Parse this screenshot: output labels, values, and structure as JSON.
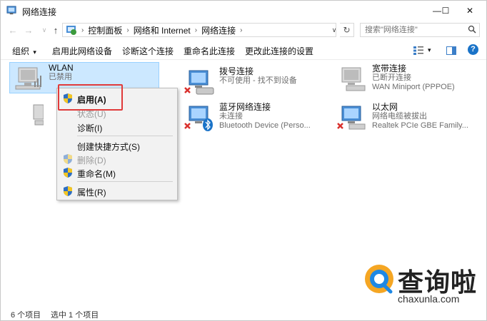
{
  "window": {
    "title": "网络连接",
    "minimize_glyph": "—",
    "maximize_glyph": "☐",
    "close_glyph": "✕"
  },
  "address": {
    "back_glyph": "←",
    "forward_glyph": "→",
    "up_glyph": "↑",
    "breadcrumb": [
      "控制面板",
      "网络和 Internet",
      "网络连接"
    ],
    "separator": "›",
    "dropdown_glyph": "∨",
    "refresh_glyph": "↻",
    "search_placeholder": "搜索\"网络连接\""
  },
  "toolbar": {
    "items": [
      "组织",
      "启用此网络设备",
      "诊断这个连接",
      "重命名此连接",
      "更改此连接的设置"
    ],
    "organize_arrow": "▾",
    "view_arrow": "▾",
    "help_glyph": "?"
  },
  "connections": [
    {
      "name": "WLAN",
      "status": "已禁用",
      "device": "",
      "icon": "wireless-adapter-icon",
      "selected": true
    },
    {
      "name": "拨号连接",
      "status": "不可使用 - 找不到设备",
      "device": "",
      "icon": "dialup-adapter-icon",
      "selected": false
    },
    {
      "name": "宽带连接",
      "status": "已断开连接",
      "device": "WAN Miniport (PPPOE)",
      "icon": "broadband-adapter-icon",
      "selected": false
    },
    {
      "name": "",
      "status": "",
      "device": "",
      "icon": "ethernet-adapter-icon",
      "selected": false
    },
    {
      "name": "蓝牙网络连接",
      "status": "未连接",
      "device": "Bluetooth Device (Perso...",
      "icon": "bluetooth-adapter-icon",
      "selected": false
    },
    {
      "name": "以太网",
      "status": "网络电缆被拔出",
      "device": "Realtek PCIe GBE Family...",
      "icon": "ethernet-adapter-icon",
      "selected": false
    }
  ],
  "context_menu": {
    "items": [
      {
        "label": "启用(A)",
        "shield": true,
        "disabled": false,
        "bold": true
      },
      {
        "label": "状态(U)",
        "shield": false,
        "disabled": true,
        "bold": false
      },
      {
        "label": "诊断(I)",
        "shield": false,
        "disabled": false,
        "bold": false
      },
      {
        "label": "创建快捷方式(S)",
        "shield": false,
        "disabled": false,
        "bold": false
      },
      {
        "label": "删除(D)",
        "shield": true,
        "disabled": true,
        "bold": false
      },
      {
        "label": "重命名(M)",
        "shield": true,
        "disabled": false,
        "bold": false
      },
      {
        "label": "属性(R)",
        "shield": true,
        "disabled": false,
        "bold": false
      }
    ]
  },
  "statusbar": {
    "item_count": "6 个项目",
    "selected_count": "选中 1 个项目"
  },
  "watermark": {
    "brand": "查询啦",
    "domain": "chaxunla.com"
  },
  "colors": {
    "selection_bg": "#cce8ff",
    "highlight_border": "#e03a3a",
    "accent_blue": "#1a73c8",
    "error_red": "#d9302c",
    "watermark_orange": "#f5a623",
    "watermark_blue": "#1e88e5"
  }
}
